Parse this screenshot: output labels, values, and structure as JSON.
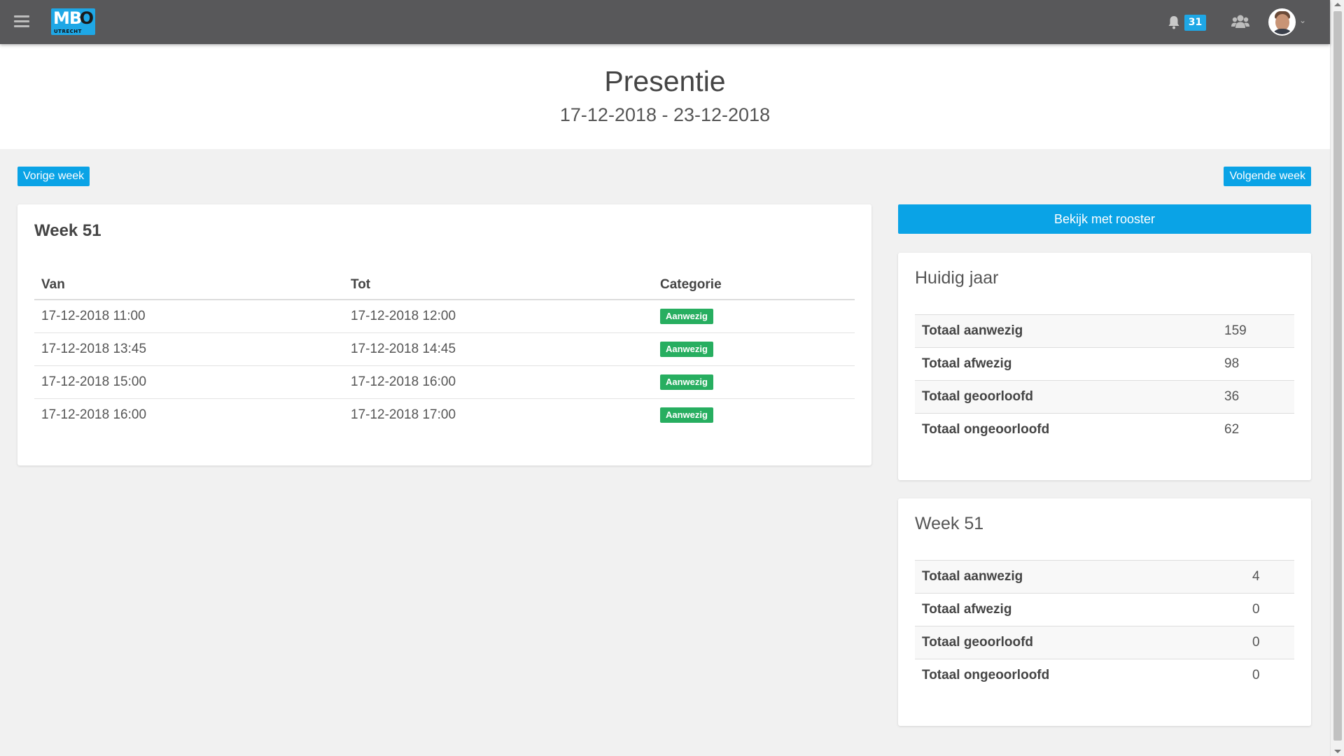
{
  "navbar": {
    "logo_text": "MB",
    "logo_o": "O",
    "logo_sub": "UTRECHT",
    "notifications_count": "31"
  },
  "header": {
    "title": "Presentie",
    "date_range": "17-12-2018 - 23-12-2018"
  },
  "buttons": {
    "prev_week": "Vorige week",
    "next_week": "Volgende week",
    "view_rooster": "Bekijk met rooster"
  },
  "attendance": {
    "title": "Week 51",
    "headers": [
      "Van",
      "Tot",
      "Categorie"
    ],
    "rows": [
      {
        "van": "17-12-2018 11:00",
        "tot": "17-12-2018 12:00",
        "categorie": "Aanwezig"
      },
      {
        "van": "17-12-2018 13:45",
        "tot": "17-12-2018 14:45",
        "categorie": "Aanwezig"
      },
      {
        "van": "17-12-2018 15:00",
        "tot": "17-12-2018 16:00",
        "categorie": "Aanwezig"
      },
      {
        "van": "17-12-2018 16:00",
        "tot": "17-12-2018 17:00",
        "categorie": "Aanwezig"
      }
    ]
  },
  "stats_year": {
    "title": "Huidig jaar",
    "rows": [
      {
        "label": "Totaal aanwezig",
        "value": "159"
      },
      {
        "label": "Totaal afwezig",
        "value": "98"
      },
      {
        "label": "Totaal geoorloofd",
        "value": "36"
      },
      {
        "label": "Totaal ongeoorloofd",
        "value": "62"
      }
    ]
  },
  "stats_week": {
    "title": "Week 51",
    "rows": [
      {
        "label": "Totaal aanwezig",
        "value": "4"
      },
      {
        "label": "Totaal afwezig",
        "value": "0"
      },
      {
        "label": "Totaal geoorloofd",
        "value": "0"
      },
      {
        "label": "Totaal ongeoorloofd",
        "value": "0"
      }
    ]
  },
  "colors": {
    "navbar": "#58585a",
    "accent": "#0aa3e6",
    "success": "#27ae60",
    "background": "#f1f1f1"
  },
  "icons": [
    "hamburger-icon",
    "bell-icon",
    "group-icon",
    "avatar",
    "chevron-down-icon"
  ]
}
